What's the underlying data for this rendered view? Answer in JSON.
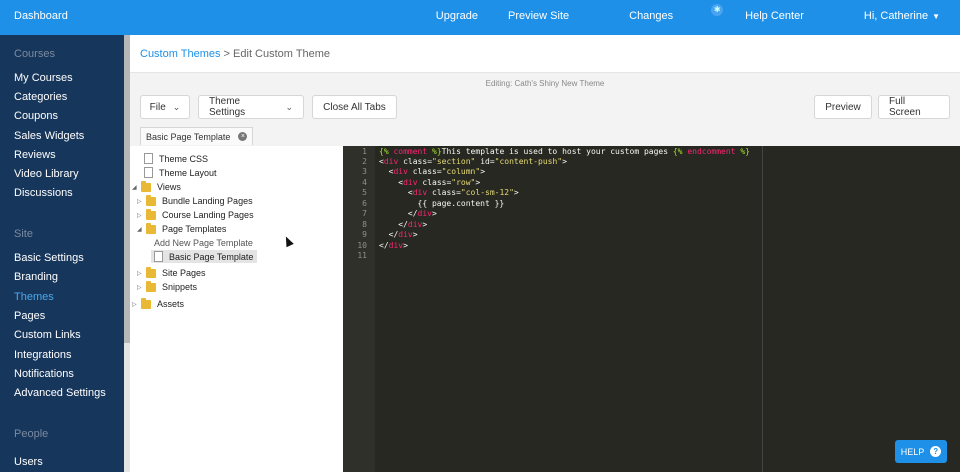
{
  "topbar": {
    "brand": "Dashboard",
    "nav": [
      "Upgrade",
      "Preview Site",
      "Changes",
      "Help Center",
      "Hi, Catherine"
    ],
    "caret": "▼"
  },
  "sidebar": {
    "sections": [
      {
        "title": "Courses",
        "items": [
          "My Courses",
          "Categories",
          "Coupons",
          "Sales Widgets",
          "Reviews",
          "Video Library",
          "Discussions"
        ]
      },
      {
        "title": "Site",
        "items": [
          "Basic Settings",
          "Branding",
          "Themes",
          "Pages",
          "Custom Links",
          "Integrations",
          "Notifications",
          "Advanced Settings"
        ]
      },
      {
        "title": "People",
        "items": [
          "Users"
        ]
      }
    ],
    "active": "Themes"
  },
  "breadcrumb": {
    "link": "Custom Themes",
    "separator": " > ",
    "current": "Edit Custom Theme"
  },
  "editing_label": "Editing: Cath's Shiny New Theme",
  "toolbar": {
    "file": "File",
    "theme_settings": "Theme Settings",
    "close_all_tabs": "Close All Tabs",
    "preview": "Preview",
    "full_screen": "Full Screen"
  },
  "open_tab": {
    "label": "Basic Page Template"
  },
  "tree": {
    "theme_css": "Theme CSS",
    "theme_layout": "Theme Layout",
    "views": "Views",
    "bundle_landing_pages": "Bundle Landing Pages",
    "course_landing_pages": "Course Landing Pages",
    "page_templates": "Page Templates",
    "add_new_page_template": "Add New Page Template",
    "basic_page_template": "Basic Page Template",
    "site_pages": "Site Pages",
    "snippets": "Snippets",
    "assets": "Assets"
  },
  "editor": {
    "line_numbers": [
      "1",
      "2",
      "3",
      "4",
      "5",
      "6",
      "7",
      "8",
      "9",
      "10",
      "11"
    ],
    "lines": [
      "{% comment %}This template is used to host your custom pages {% endcomment %}",
      "<div class=\"section\" id=\"content-push\">",
      "  <div class=\"column\">",
      "    <div class=\"row\">",
      "      <div class=\"col-sm-12\">",
      "        {{ page.content }}",
      "      </div>",
      "    </div>",
      "  </div>",
      "</div>",
      ""
    ]
  },
  "help": {
    "label": "HELP",
    "icon": "?"
  }
}
